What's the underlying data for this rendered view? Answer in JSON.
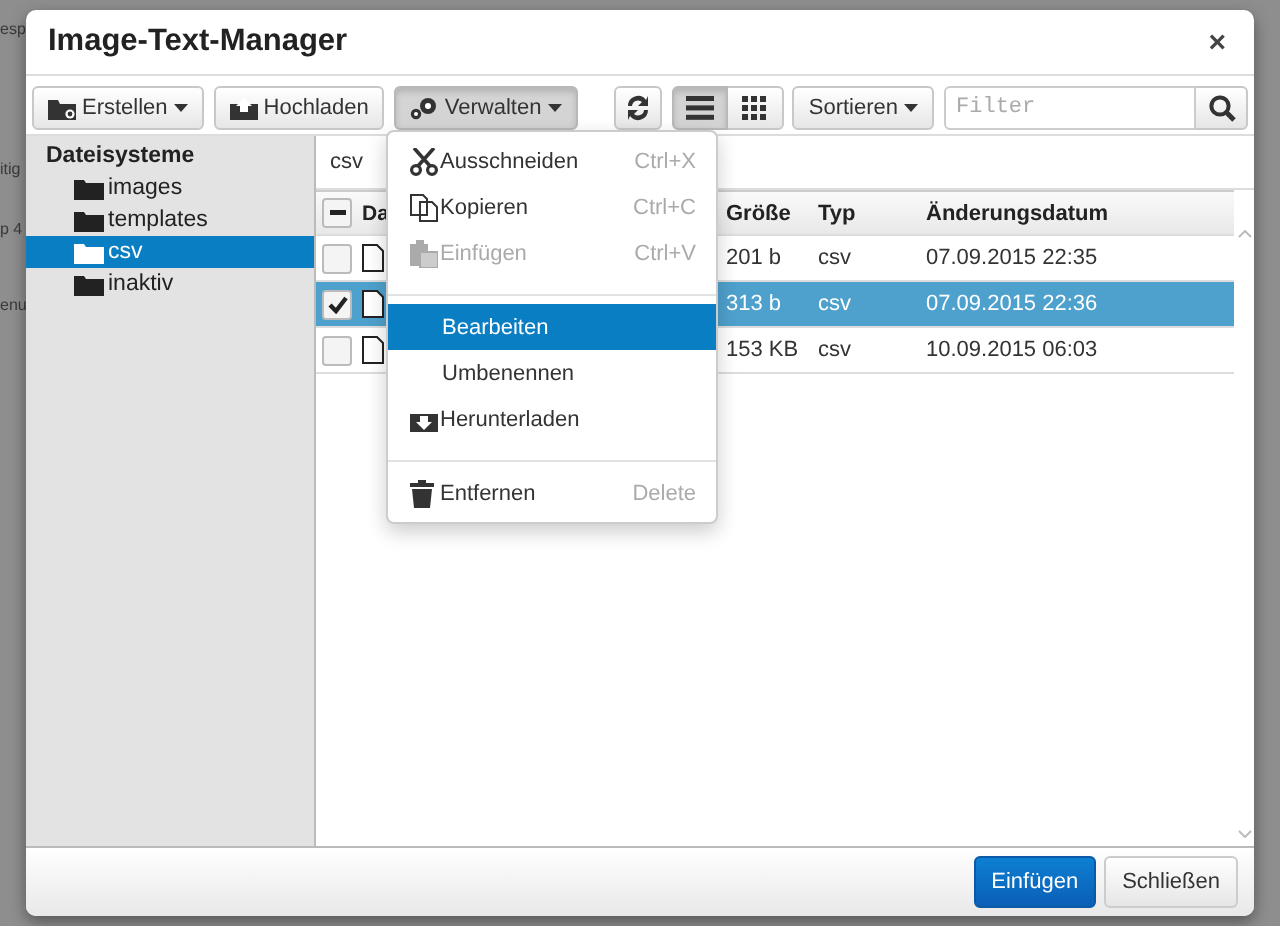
{
  "background_fragments": [
    "esp",
    "itig",
    "p 4",
    "enu"
  ],
  "window": {
    "title": "Image-Text-Manager",
    "close": "×"
  },
  "toolbar": {
    "buttons": [
      {
        "kind": "dropdown",
        "label": "Erstellen",
        "pressed": false
      },
      {
        "kind": "plain",
        "label": "Hochladen",
        "pressed": false
      },
      {
        "kind": "dropdown",
        "label": "Verwalten",
        "pressed": true
      }
    ],
    "view_modes": [
      {
        "selected": true
      },
      {
        "selected": false
      }
    ],
    "sort": {
      "label": "Sortieren"
    },
    "filter": {
      "placeholder": "Filter"
    }
  },
  "tree": {
    "title": "Dateisysteme",
    "children": [
      {
        "label": "images",
        "selected": false
      },
      {
        "label": "templates",
        "selected": false
      },
      {
        "label": "csv",
        "selected": true
      },
      {
        "label": "inaktiv",
        "selected": false
      }
    ]
  },
  "path": "csv",
  "table": {
    "columns": [
      "Da",
      "Größe",
      "Typ",
      "Änderungsdatum"
    ],
    "select_all": {
      "indeterminate": true
    },
    "rows": [
      {
        "selected": false,
        "checked": false,
        "cells": [
          "",
          "201 b",
          "csv",
          "07.09.2015 22:35"
        ]
      },
      {
        "selected": true,
        "checked": true,
        "cells": [
          "",
          "313 b",
          "csv",
          "07.09.2015 22:36"
        ]
      },
      {
        "selected": false,
        "checked": false,
        "cells": [
          "",
          "153 KB",
          "csv",
          "10.09.2015 06:03"
        ]
      }
    ]
  },
  "menu": {
    "items": [
      {
        "kind": "item",
        "label": "Ausschneiden",
        "shortcut": "Ctrl+X",
        "disabled": false,
        "selected": false
      },
      {
        "kind": "item",
        "label": "Kopieren",
        "shortcut": "Ctrl+C",
        "disabled": false,
        "selected": false
      },
      {
        "kind": "item",
        "label": "Einfügen",
        "shortcut": "Ctrl+V",
        "disabled": true,
        "selected": false
      },
      {
        "kind": "divider"
      },
      {
        "kind": "item",
        "label": "Bearbeiten",
        "disabled": false,
        "selected": true
      },
      {
        "kind": "item",
        "label": "Umbenennen",
        "disabled": false,
        "selected": false
      },
      {
        "kind": "item",
        "label": "Herunterladen",
        "disabled": false,
        "selected": false
      },
      {
        "kind": "divider"
      },
      {
        "kind": "item",
        "label": "Entfernen",
        "shortcut": "Delete",
        "disabled": false,
        "selected": false
      }
    ]
  },
  "footer": {
    "buttons": [
      {
        "label": "Einfügen",
        "primary": true
      },
      {
        "label": "Schließen",
        "primary": false
      }
    ]
  }
}
